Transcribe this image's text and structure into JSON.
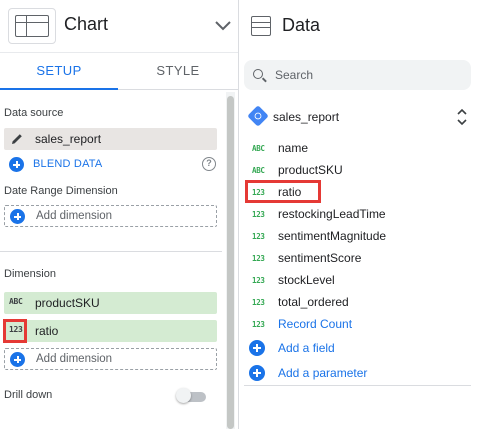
{
  "left_panel": {
    "title": "Chart",
    "tabs": [
      {
        "label": "SETUP",
        "active": true
      },
      {
        "label": "STYLE",
        "active": false
      }
    ],
    "data_source": {
      "label": "Data source",
      "value": "sales_report",
      "icon": "pencil-icon"
    },
    "blend_data_label": "BLEND DATA",
    "date_range": {
      "label": "Date Range Dimension",
      "add_label": "Add dimension"
    },
    "dimension": {
      "label": "Dimension",
      "items": [
        {
          "type_badge": "ABC",
          "name": "productSKU"
        },
        {
          "type_badge": "123",
          "name": "ratio"
        }
      ],
      "add_label": "Add dimension"
    },
    "drill_down": {
      "label": "Drill down",
      "enabled": false
    }
  },
  "right_panel": {
    "title": "Data",
    "search_placeholder": "Search",
    "source_name": "sales_report",
    "fields": [
      {
        "type_badge": "ABC",
        "name": "name"
      },
      {
        "type_badge": "ABC",
        "name": "productSKU"
      },
      {
        "type_badge": "123",
        "name": "ratio"
      },
      {
        "type_badge": "123",
        "name": "restockingLeadTime"
      },
      {
        "type_badge": "123",
        "name": "sentimentMagnitude"
      },
      {
        "type_badge": "123",
        "name": "sentimentScore"
      },
      {
        "type_badge": "123",
        "name": "stockLevel"
      },
      {
        "type_badge": "123",
        "name": "total_ordered"
      },
      {
        "type_badge": "123",
        "name": "Record Count"
      }
    ],
    "add_field_label": "Add a field",
    "add_parameter_label": "Add a parameter"
  },
  "colors": {
    "accent": "#1a73e8",
    "highlight_box": "#e53935",
    "dimension_chip": "#d4ebd2",
    "source_chip": "#e8e5e3",
    "number_badge": "#34a853"
  }
}
